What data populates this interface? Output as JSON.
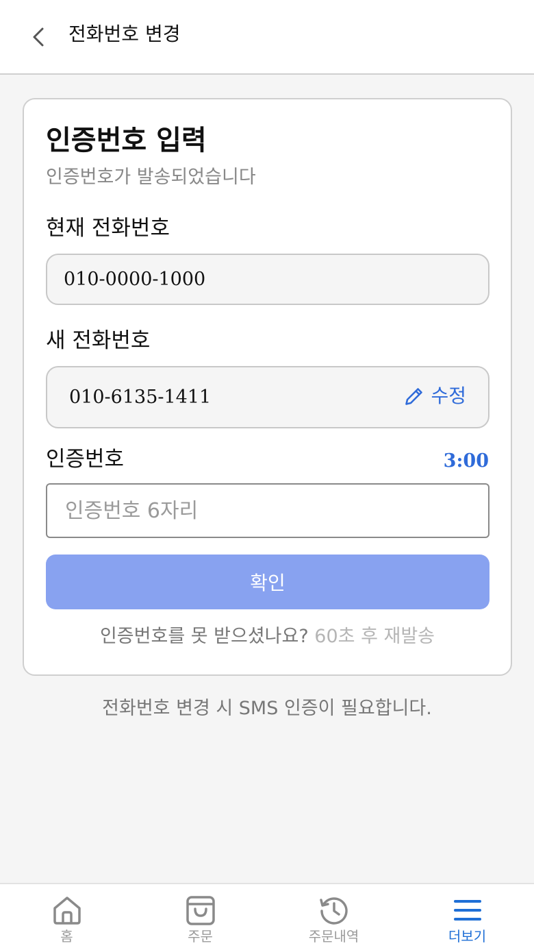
{
  "header": {
    "title": "전화번호 변경",
    "back_icon": "chevron-left-icon"
  },
  "card": {
    "title": "인증번호 입력",
    "subtitle": "인증번호가 발송되었습니다",
    "current_phone": {
      "label": "현재 전화번호",
      "value": "010-0000-1000"
    },
    "new_phone": {
      "label": "새 전화번호",
      "value": "010-6135-1411",
      "edit_label": "수정",
      "edit_icon": "pencil-icon"
    },
    "code": {
      "label": "인증번호",
      "timer": "3:00",
      "placeholder": "인증번호 6자리",
      "value": ""
    },
    "confirm_label": "확인",
    "resend": {
      "question": "인증번호를 못 받으셨나요?",
      "countdown": "60초 후 재발송"
    }
  },
  "footer_note": "전화번호 변경 시 SMS 인증이 필요합니다.",
  "nav": {
    "items": [
      {
        "label": "홈",
        "icon": "home-icon",
        "active": false
      },
      {
        "label": "주문",
        "icon": "shopping-bag-icon",
        "active": false
      },
      {
        "label": "주문내역",
        "icon": "history-icon",
        "active": false
      },
      {
        "label": "더보기",
        "icon": "menu-icon",
        "active": true
      }
    ]
  },
  "colors": {
    "accent": "#2f6bd9",
    "button": "#88a2f0",
    "nav_active": "#1f6fd6"
  }
}
